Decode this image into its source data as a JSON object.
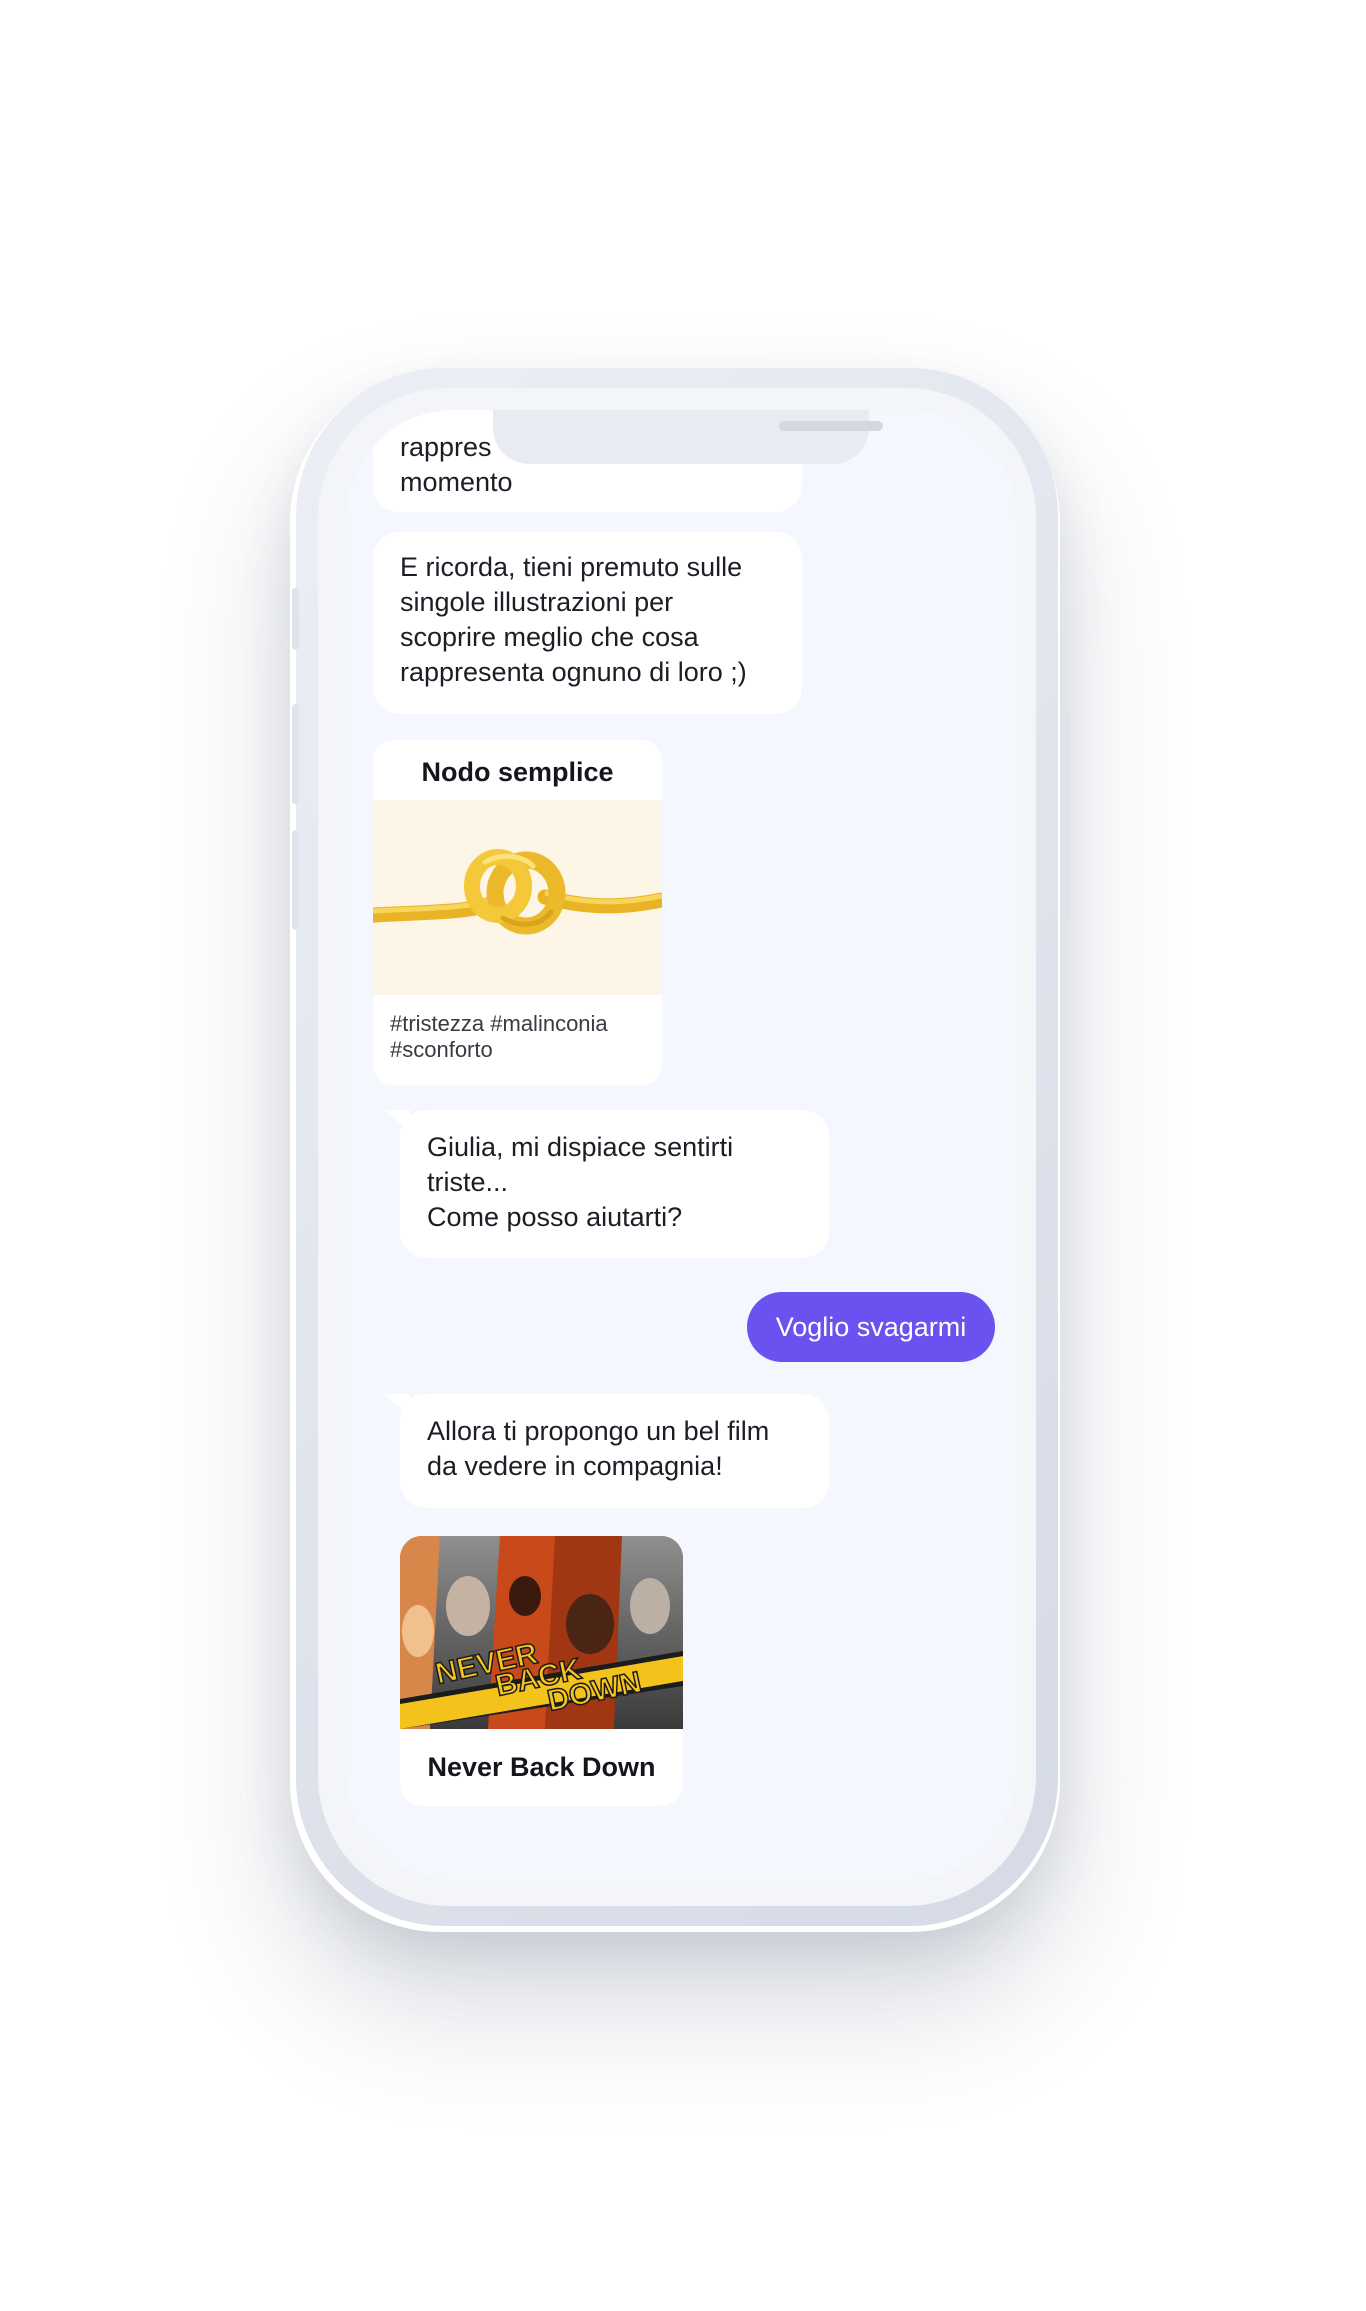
{
  "chat": {
    "messages": [
      {
        "sender": "bot",
        "type": "text",
        "lines": [
          "rappres",
          "momento"
        ]
      },
      {
        "sender": "bot",
        "type": "text",
        "lines": [
          "E ricorda, tieni premuto sulle",
          "singole illustrazioni per",
          "scoprire meglio che cosa",
          "rappresenta ognuno di loro ;)"
        ]
      },
      {
        "sender": "bot",
        "type": "card",
        "title": "Nodo semplice",
        "image_icon": "yellow-knot-icon",
        "tags": [
          "#tristezza #malinconia",
          "#sconforto"
        ]
      },
      {
        "sender": "bot",
        "type": "text",
        "lines": [
          "Giulia, mi dispiace sentirti",
          "triste...",
          "Come posso aiutarti?"
        ]
      },
      {
        "sender": "user",
        "type": "text",
        "text": "Voglio svagarmi"
      },
      {
        "sender": "bot",
        "type": "text",
        "lines": [
          "Allora ti propongo un bel film",
          "da vedere in compagnia!"
        ]
      },
      {
        "sender": "bot",
        "type": "movie",
        "poster_text": [
          "NEVER",
          "BACK",
          "DOWN"
        ],
        "title": "Never Back Down"
      }
    ]
  },
  "colors": {
    "screen_background": "#f4f7fe",
    "bot_bubble": "#ffffff",
    "user_bubble": "#6a52f0",
    "knot": "#f2c232",
    "knot_background": "#fdf6e6"
  }
}
